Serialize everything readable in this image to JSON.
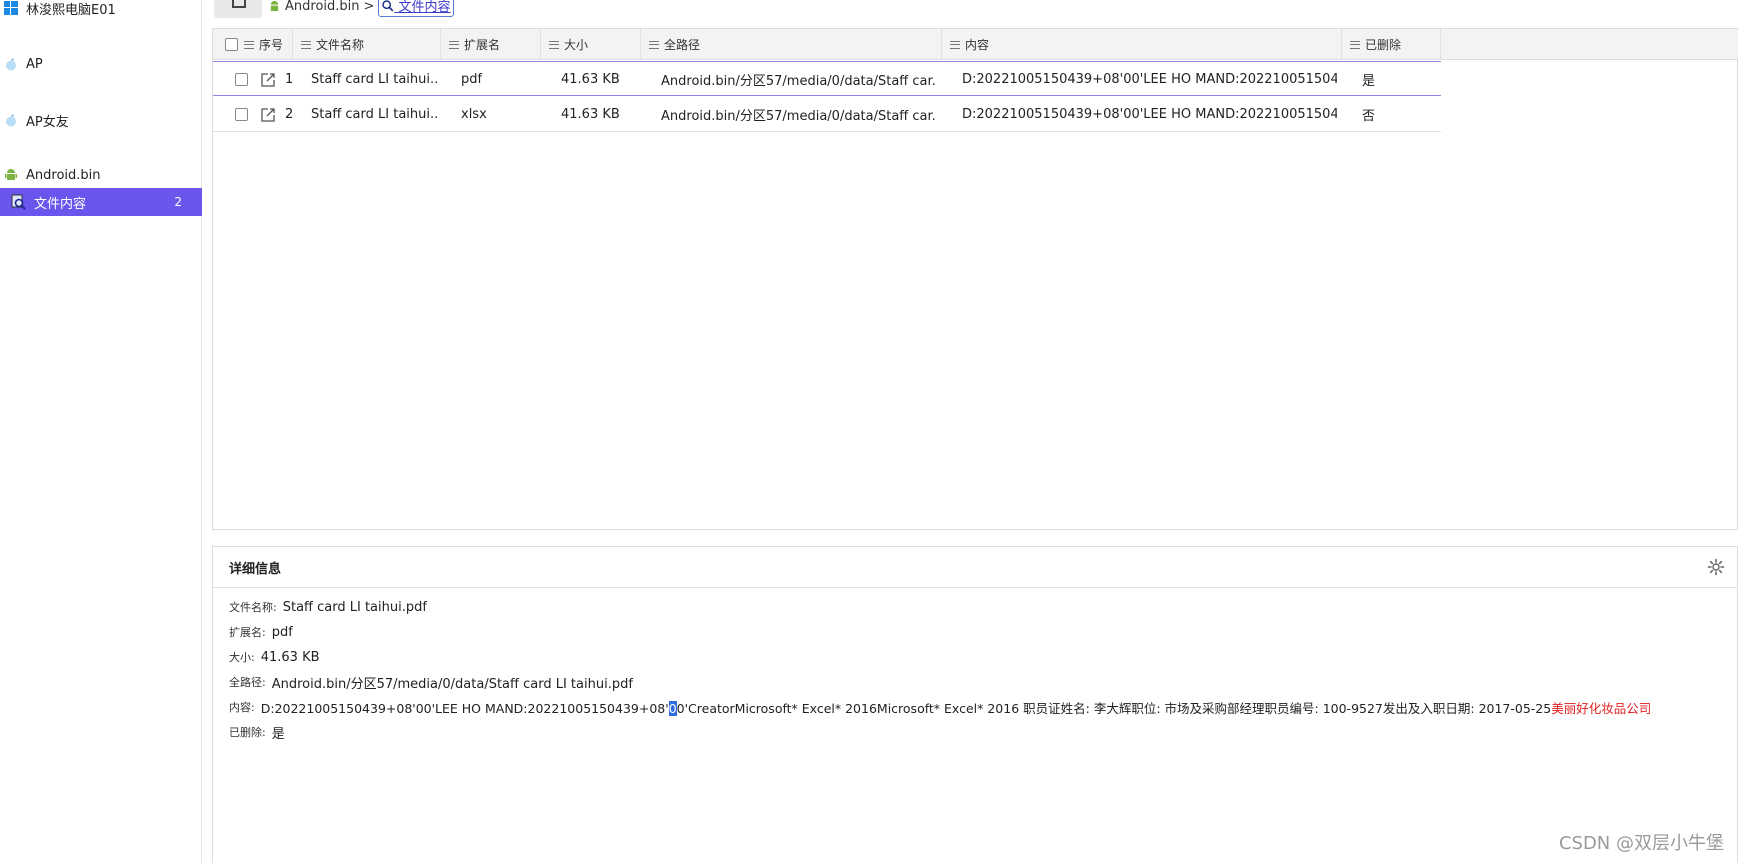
{
  "sidebar": {
    "items": [
      {
        "label": "林浚熙电脑E01",
        "icon": "windows-icon"
      },
      {
        "label": "AP",
        "icon": "apple-icon"
      },
      {
        "label": "AP女友",
        "icon": "apple-icon"
      },
      {
        "label": "Android.bin",
        "icon": "android-icon"
      },
      {
        "label": "文件内容",
        "icon": "search-doc-icon",
        "count": "2",
        "selected": true
      }
    ]
  },
  "breadcrumb": {
    "parent": "Android.bin",
    "separator": ">",
    "current": "文件内容"
  },
  "grid": {
    "columns": [
      "序号",
      "文件名称",
      "扩展名",
      "大小",
      "全路径",
      "内容",
      "已删除"
    ],
    "rows": [
      {
        "index": "1",
        "name": "Staff card LI taihui....",
        "ext": "pdf",
        "size": "41.63 KB",
        "path": "Android.bin/分区57/media/0/data/Staff car...",
        "content": "D:20221005150439+08'00'LEE HO MAND:202210051504...",
        "deleted": "是"
      },
      {
        "index": "2",
        "name": "Staff card LI taihui....",
        "ext": "xlsx",
        "size": "41.63 KB",
        "path": "Android.bin/分区57/media/0/data/Staff car...",
        "content": "D:20221005150439+08'00'LEE HO MAND:202210051504...",
        "deleted": "否"
      }
    ]
  },
  "detail": {
    "title": "详细信息",
    "fields": {
      "name_label": "文件名称:",
      "name_value": "Staff card LI taihui.pdf",
      "ext_label": "扩展名:",
      "ext_value": "pdf",
      "size_label": "大小:",
      "size_value": "41.63 KB",
      "path_label": "全路径:",
      "path_value": "Android.bin/分区57/media/0/data/Staff card LI taihui.pdf",
      "content_label": "内容:",
      "content_part1": "D:20221005150439+08'00'LEE HO MAND:20221005150439+08'",
      "content_selected": "0",
      "content_part2": "0'CreatorMicrosoft* Excel* 2016Microsoft* Excel* 2016 职员证姓名: 李大辉职位:  市场及采购部经理职员编号:  100-9527发出及入职日期: 2017-05-25",
      "content_red": "美丽好化妆品公司",
      "deleted_label": "已删除:",
      "deleted_value": "是"
    }
  },
  "watermark": "CSDN @双层小牛堡",
  "colors": {
    "accent": "#6a56ec",
    "selection": "#2f6de0",
    "highlight_red": "#e02020"
  }
}
